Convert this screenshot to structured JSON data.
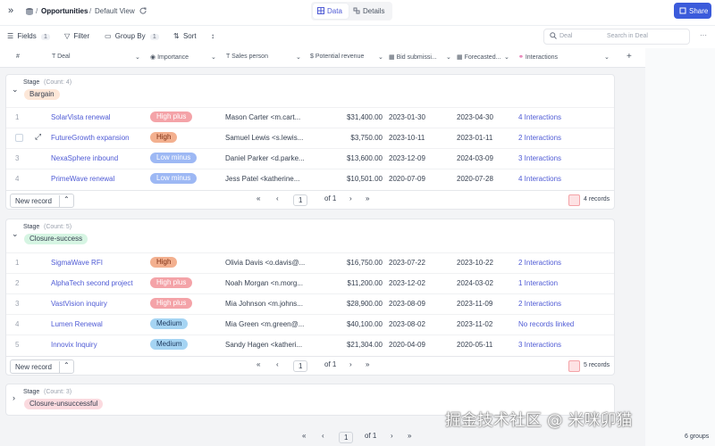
{
  "topbar": {
    "expand_icon": "»",
    "breadcrumb_sep": "/",
    "breadcrumb_base": "Opportunities",
    "breadcrumb_view": "Default View",
    "tabs": [
      {
        "label": "Data"
      },
      {
        "label": "Details"
      }
    ],
    "share_label": "Share"
  },
  "toolbar": {
    "fields_label": "Fields",
    "fields_count": "1",
    "filter_label": "Filter",
    "groupby_label": "Group By",
    "groupby_count": "1",
    "sort_label": "Sort",
    "search_field": "Deal",
    "search_placeholder": "Search in Deal"
  },
  "columns": [
    "#",
    "Deal",
    "Importance",
    "Sales person",
    "Potential revenue",
    "Bid submissi...",
    "Forecasted...",
    "Interactions"
  ],
  "groups": [
    {
      "stage_label": "Stage",
      "count_label": "(Count: 4)",
      "stage": "Bargain",
      "stage_color": "#fde7d8",
      "rows": [
        {
          "num": "1",
          "deal": "SolarVista renewal",
          "importance": "High plus",
          "sales": "Mason Carter <m.cart...",
          "revenue": "$31,400.00",
          "bid": "2023-01-30",
          "forecast": "2023-04-30",
          "interactions": "4 Interactions"
        },
        {
          "num": "",
          "deal": "FutureGrowth expansion",
          "importance": "High",
          "sales": "Samuel Lewis <s.lewis...",
          "revenue": "$3,750.00",
          "bid": "2023-10-11",
          "forecast": "2023-01-11",
          "interactions": "2 Interactions"
        },
        {
          "num": "3",
          "deal": "NexaSphere inbound",
          "importance": "Low minus",
          "sales": "Daniel Parker <d.parke...",
          "revenue": "$13,600.00",
          "bid": "2023-12-09",
          "forecast": "2024-03-09",
          "interactions": "3 Interactions"
        },
        {
          "num": "4",
          "deal": "PrimeWave renewal",
          "importance": "Low minus",
          "sales": "Jess Patel <katherine...",
          "revenue": "$10,501.00",
          "bid": "2020-07-09",
          "forecast": "2020-07-28",
          "interactions": "4 Interactions"
        }
      ],
      "new_record": "New record",
      "page": "1",
      "of_label": "of 1",
      "records": "4 records"
    },
    {
      "stage_label": "Stage",
      "count_label": "(Count: 5)",
      "stage": "Closure-success",
      "stage_color": "#d6f5e3",
      "rows": [
        {
          "num": "1",
          "deal": "SigmaWave RFI",
          "importance": "High",
          "sales": "Olivia Davis <o.davis@...",
          "revenue": "$16,750.00",
          "bid": "2023-07-22",
          "forecast": "2023-10-22",
          "interactions": "2 Interactions"
        },
        {
          "num": "2",
          "deal": "AlphaTech second project",
          "importance": "High plus",
          "sales": "Noah Morgan <n.morg...",
          "revenue": "$11,200.00",
          "bid": "2023-12-02",
          "forecast": "2024-03-02",
          "interactions": "1 Interaction"
        },
        {
          "num": "3",
          "deal": "VastVision inquiry",
          "importance": "High plus",
          "sales": "Mia Johnson <m.johns...",
          "revenue": "$28,900.00",
          "bid": "2023-08-09",
          "forecast": "2023-11-09",
          "interactions": "2 Interactions"
        },
        {
          "num": "4",
          "deal": "Lumen Renewal",
          "importance": "Medium",
          "sales": "Mia Green <m.green@...",
          "revenue": "$40,100.00",
          "bid": "2023-08-02",
          "forecast": "2023-11-02",
          "interactions": "No records linked"
        },
        {
          "num": "5",
          "deal": "Innovix Inquiry",
          "importance": "Medium",
          "sales": "Sandy Hagen <katheri...",
          "revenue": "$21,304.00",
          "bid": "2020-04-09",
          "forecast": "2020-05-11",
          "interactions": "3 Interactions"
        }
      ],
      "new_record": "New record",
      "page": "1",
      "of_label": "of 1",
      "records": "5 records"
    },
    {
      "stage_label": "Stage",
      "count_label": "(Count: 3)",
      "stage": "Closure-unsuccessful",
      "stage_color": "#fbdadf"
    }
  ],
  "importance_colors": {
    "High plus": "#f4a3a8",
    "High": "#f3b08f",
    "Low minus": "#9db8f4",
    "Medium": "#a5d4f3"
  },
  "footer": {
    "page": "1",
    "of_label": "of 1",
    "groups_count": "6 groups"
  },
  "watermark": "掘金技术社区 @ 米咪卯猫"
}
